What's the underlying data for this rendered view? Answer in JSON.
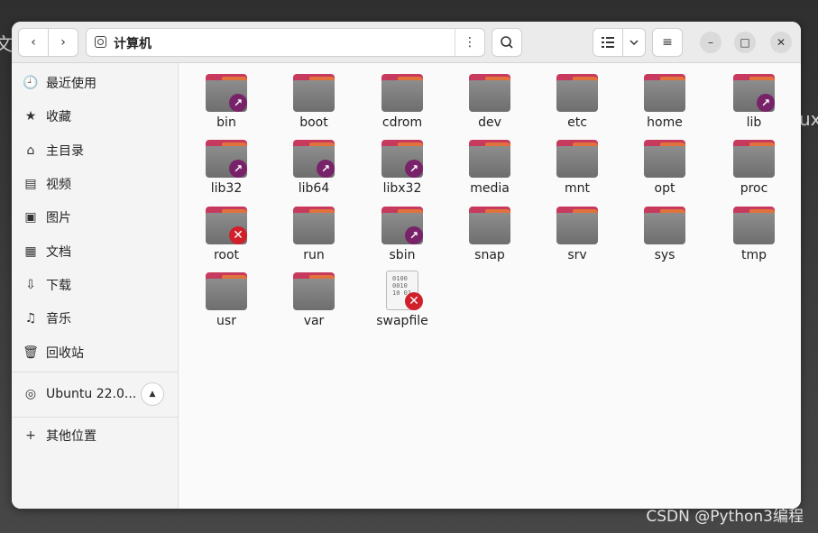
{
  "background": {
    "left_text": "文件",
    "right_text": "ux",
    "watermark": "CSDN @Python3编程"
  },
  "toolbar": {
    "back_icon": "‹",
    "forward_icon": "›",
    "path_label": "计算机",
    "path_menu_icon": "⋮",
    "search_icon": "search-icon",
    "view_icon": "list-view-icon",
    "view_dropdown_icon": "⌄",
    "menu_icon": "≡",
    "minimize": "–",
    "maximize": "□",
    "close": "✕"
  },
  "sidebar": {
    "items": [
      {
        "label": "最近使用",
        "icon": "🕘"
      },
      {
        "label": "收藏",
        "icon": "★"
      },
      {
        "label": "主目录",
        "icon": "⌂"
      },
      {
        "label": "视频",
        "icon": "▤"
      },
      {
        "label": "图片",
        "icon": "▣"
      },
      {
        "label": "文档",
        "icon": "▦"
      },
      {
        "label": "下载",
        "icon": "⇩"
      },
      {
        "label": "音乐",
        "icon": "♫"
      },
      {
        "label": "回收站",
        "icon": "🗑"
      }
    ],
    "device": {
      "label": "Ubuntu 22.0...",
      "icon": "◎",
      "eject": "▲"
    },
    "other": {
      "label": "其他位置",
      "icon": "+"
    }
  },
  "files": [
    {
      "name": "bin",
      "emblem": "link"
    },
    {
      "name": "boot",
      "emblem": ""
    },
    {
      "name": "cdrom",
      "emblem": ""
    },
    {
      "name": "dev",
      "emblem": ""
    },
    {
      "name": "etc",
      "emblem": ""
    },
    {
      "name": "home",
      "emblem": ""
    },
    {
      "name": "lib",
      "emblem": "link"
    },
    {
      "name": "lib32",
      "emblem": "link"
    },
    {
      "name": "lib64",
      "emblem": "link"
    },
    {
      "name": "libx32",
      "emblem": "link"
    },
    {
      "name": "media",
      "emblem": ""
    },
    {
      "name": "mnt",
      "emblem": ""
    },
    {
      "name": "opt",
      "emblem": ""
    },
    {
      "name": "proc",
      "emblem": ""
    },
    {
      "name": "root",
      "emblem": "lock"
    },
    {
      "name": "run",
      "emblem": ""
    },
    {
      "name": "sbin",
      "emblem": "link"
    },
    {
      "name": "snap",
      "emblem": ""
    },
    {
      "name": "srv",
      "emblem": ""
    },
    {
      "name": "sys",
      "emblem": ""
    },
    {
      "name": "tmp",
      "emblem": ""
    },
    {
      "name": "usr",
      "emblem": ""
    },
    {
      "name": "var",
      "emblem": ""
    },
    {
      "name": "swapfile",
      "emblem": "lock",
      "kind": "binary",
      "preview": "0100 0010 10 01"
    }
  ],
  "colors": {
    "folder_tab": "#c73a5d",
    "folder_tab_right": "#e2723c",
    "folder_body": "#7d7d7d",
    "emblem_link": "#78226a",
    "emblem_lock": "#d0212b"
  }
}
